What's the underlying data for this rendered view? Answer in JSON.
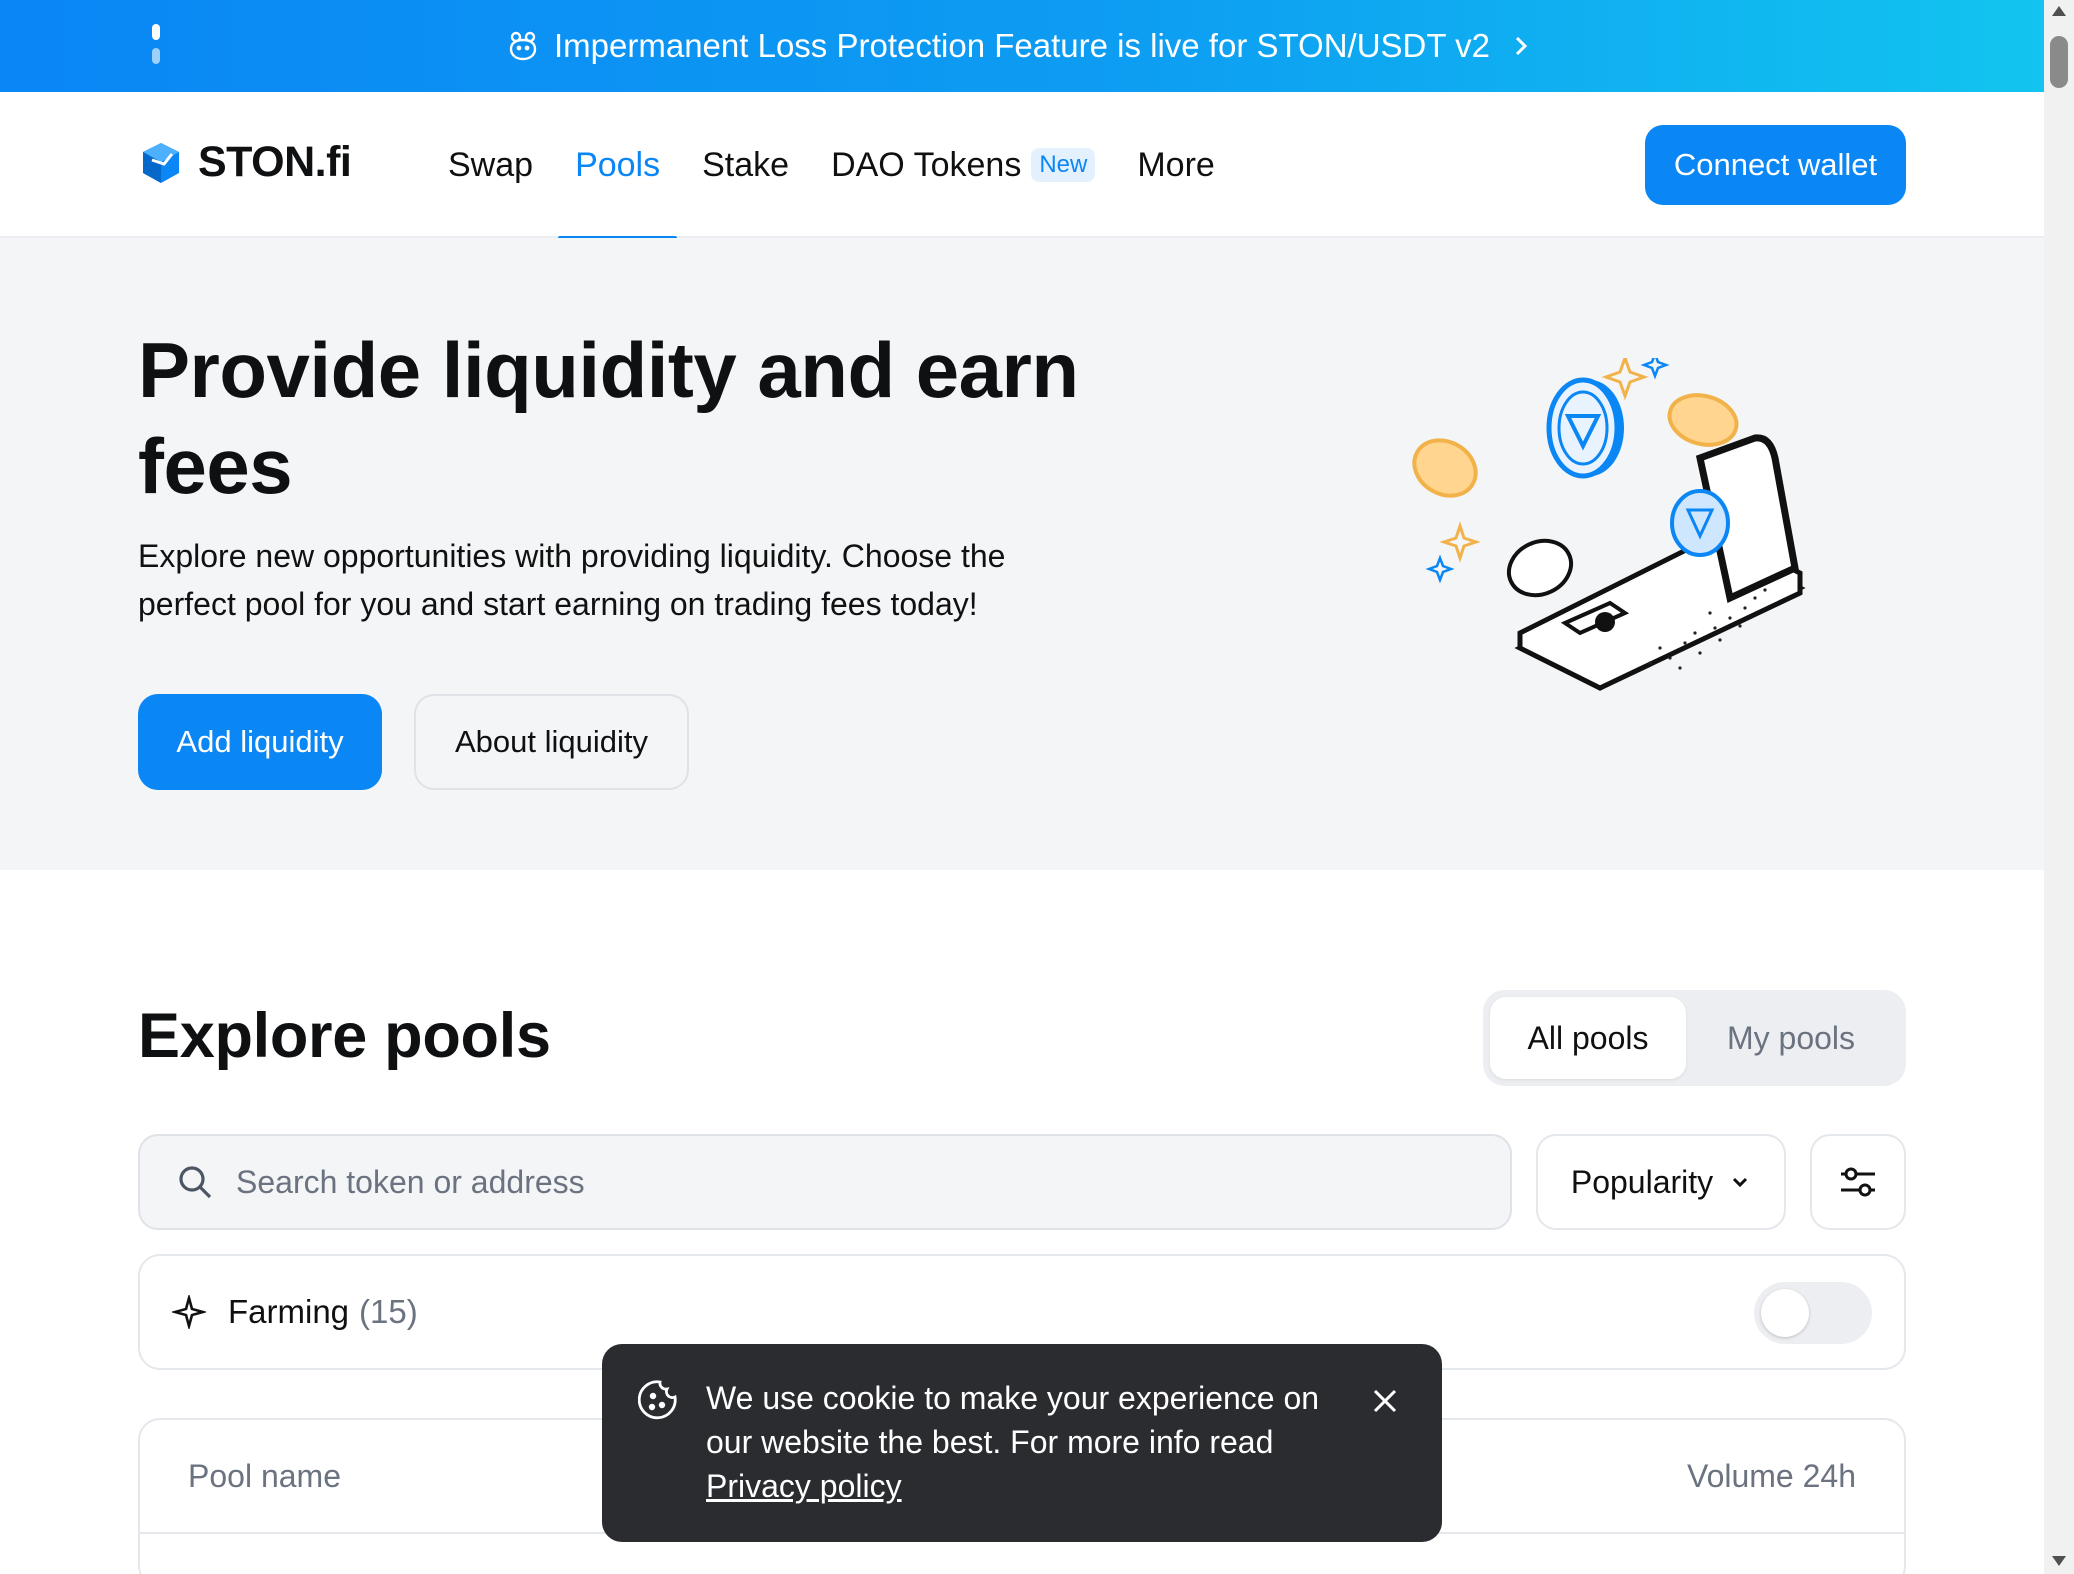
{
  "banner": {
    "text": "Impermanent Loss Protection Feature is live for STON/USDT v2",
    "icon": "mascot-icon",
    "arrow_icon": "chevron-right-icon"
  },
  "nav": {
    "logo_text": "STON.fi",
    "items": [
      {
        "label": "Swap",
        "active": false
      },
      {
        "label": "Pools",
        "active": true
      },
      {
        "label": "Stake",
        "active": false
      },
      {
        "label": "DAO Tokens",
        "active": false,
        "badge": "New"
      },
      {
        "label": "More",
        "active": false
      }
    ],
    "connect_label": "Connect wallet"
  },
  "hero": {
    "title": "Provide liquidity and earn fees",
    "description": "Explore new opportunities with providing liquidity. Choose the perfect pool for you and start earning on trading fees today!",
    "primary_button": "Add liquidity",
    "secondary_button": "About liquidity"
  },
  "explore": {
    "title": "Explore pools",
    "tabs": [
      "All pools",
      "My pools"
    ],
    "active_tab": "All pools",
    "search_placeholder": "Search token or address",
    "sort_label": "Popularity",
    "farming_label": "Farming",
    "farming_count": "(15)",
    "farming_enabled": false
  },
  "table": {
    "columns": [
      "Pool name",
      "Volume 24h"
    ]
  },
  "cookie": {
    "text": "We use cookie to make your experience on our website the best. For more info read",
    "link": "Privacy policy"
  },
  "colors": {
    "accent": "#0a86f5",
    "hero_bg": "#f4f5f7",
    "cookie_bg": "#2b2c30"
  }
}
